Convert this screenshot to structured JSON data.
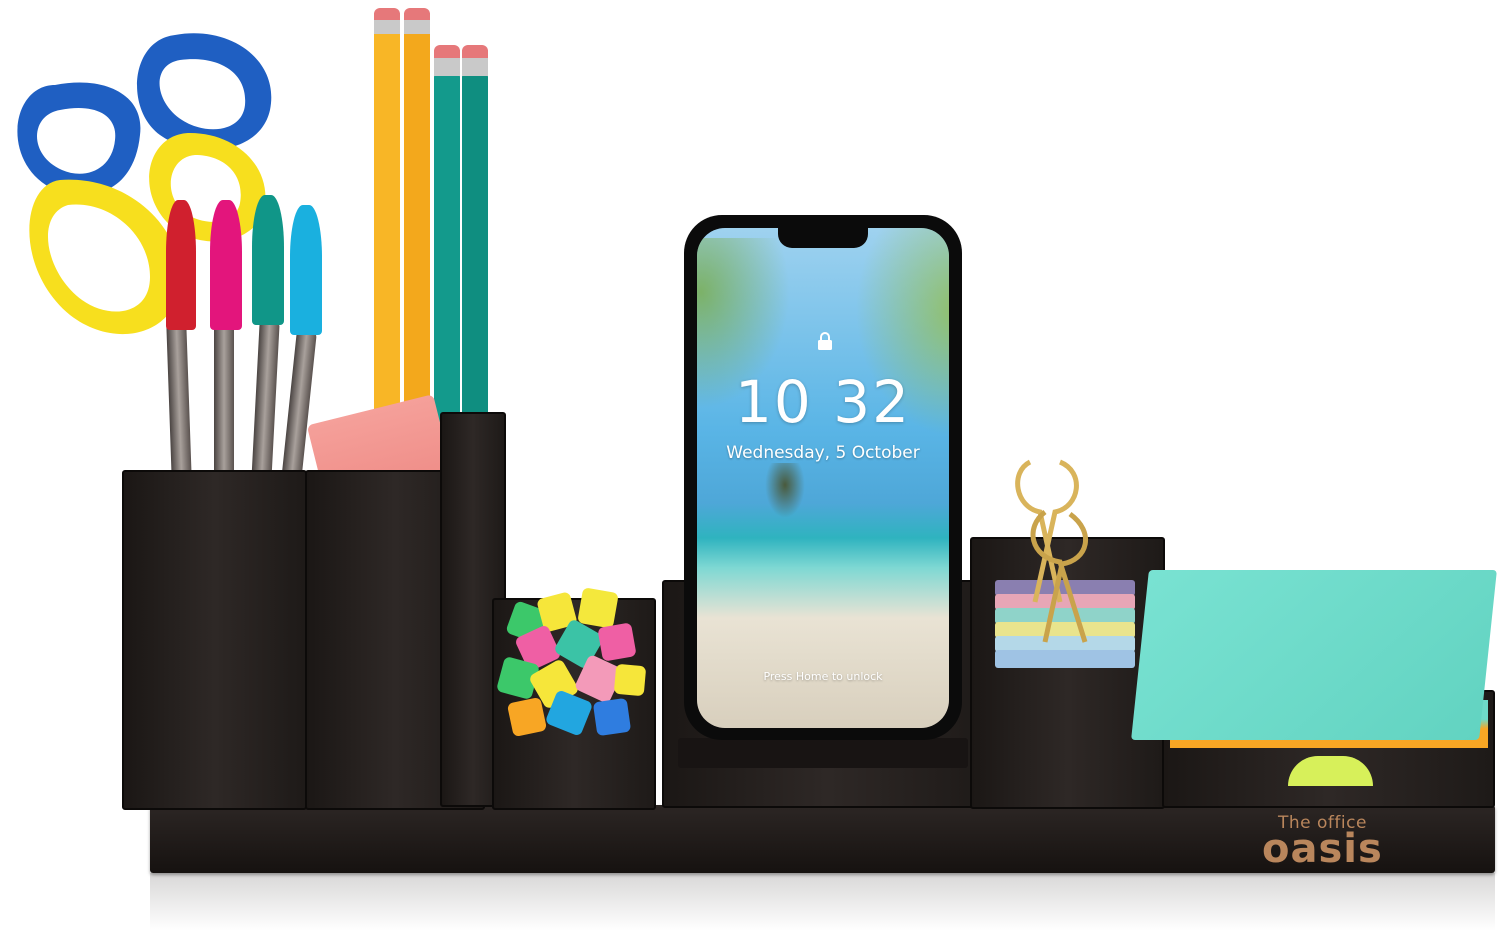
{
  "scene": {
    "description_subject": "desk organizer product photo",
    "background_color": "#ffffff",
    "organizer_color": "#221d1b"
  },
  "phone": {
    "time": "10 32",
    "date": "Wednesday, 5 October",
    "unlock_hint": "Press Home to unlock",
    "icons": [
      "lock-icon"
    ]
  },
  "logo": {
    "line1": "The office",
    "line2": "oasis",
    "color": "#b9865c"
  },
  "colors": {
    "scissors_blue": "#1f5fc2",
    "scissors_yellow": "#f7df1e",
    "pencil_orange": "#f8b626",
    "pencil_teal": "#139a8c",
    "pen_red": "#d0202e",
    "pen_pink": "#e3157c",
    "pen_teal": "#109688",
    "pen_cyan": "#1ab0df",
    "eraser_pink": "#f08a86",
    "sticky_teal": "#6edac9",
    "sticky_orange": "#f8a624",
    "sticky_lime": "#d7f05a"
  }
}
